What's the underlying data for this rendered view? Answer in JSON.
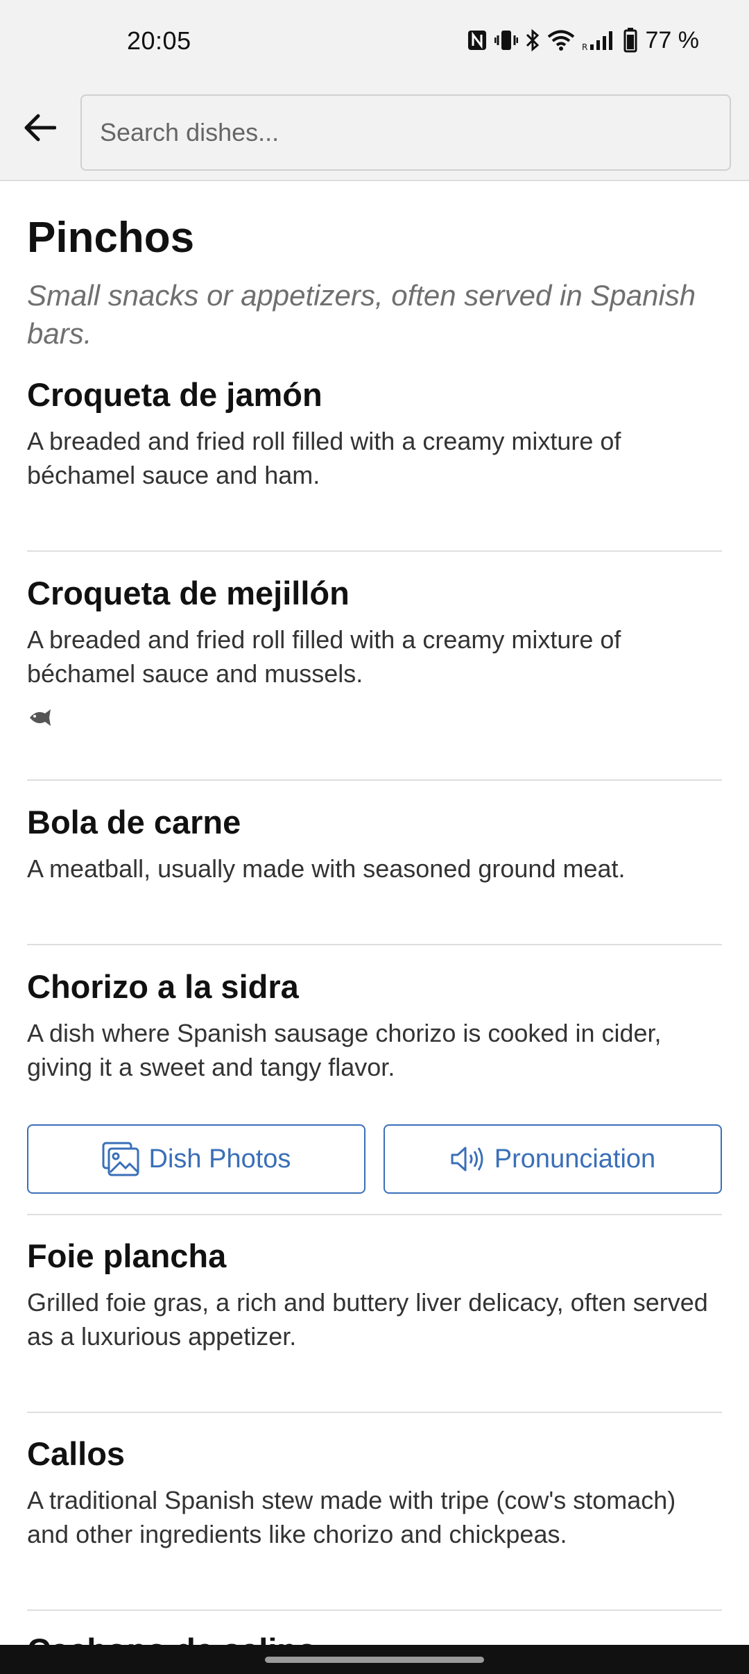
{
  "status_bar": {
    "time": "20:05",
    "battery_percent": "77 %",
    "icons": [
      "nfc-icon",
      "vibrate-icon",
      "bluetooth-icon",
      "wifi-icon",
      "signal-icon",
      "battery-icon"
    ]
  },
  "header": {
    "back_icon": "arrow-left-icon",
    "search_placeholder": "Search dishes...",
    "search_value": ""
  },
  "section": {
    "title": "Pinchos",
    "subtitle": "Small snacks or appetizers, often served in Spanish bars."
  },
  "dishes": [
    {
      "name": "Croqueta de jamón",
      "description": "A breaded and fried roll filled with a creamy mixture of béchamel sauce and ham."
    },
    {
      "name": "Croqueta de mejillón",
      "description": "A breaded and fried roll filled with a creamy mixture of béchamel sauce and mussels.",
      "tag_icon": "fish-icon"
    },
    {
      "name": "Bola de carne",
      "description": "A meatball, usually made with seasoned ground meat."
    },
    {
      "name": "Chorizo a la sidra",
      "description": "A dish where Spanish sausage chorizo is cooked in cider, giving it a sweet and tangy flavor.",
      "actions": {
        "photos_label": "Dish Photos",
        "photos_icon": "image-icon",
        "pronunciation_label": "Pronunciation",
        "pronunciation_icon": "speaker-icon"
      }
    },
    {
      "name": "Foie plancha",
      "description": "Grilled foie gras, a rich and buttery liver delicacy, often served as a luxurious appetizer."
    },
    {
      "name": "Callos",
      "description": "A traditional Spanish stew made with tripe (cow's stomach) and other ingredients like chorizo and chickpeas."
    }
  ],
  "peek_item": "Cachopo de salino",
  "colors": {
    "accent": "#3a6fb8",
    "header_bg": "#f2f2f2",
    "divider": "#dedede",
    "subtitle": "#6f6f6f"
  }
}
